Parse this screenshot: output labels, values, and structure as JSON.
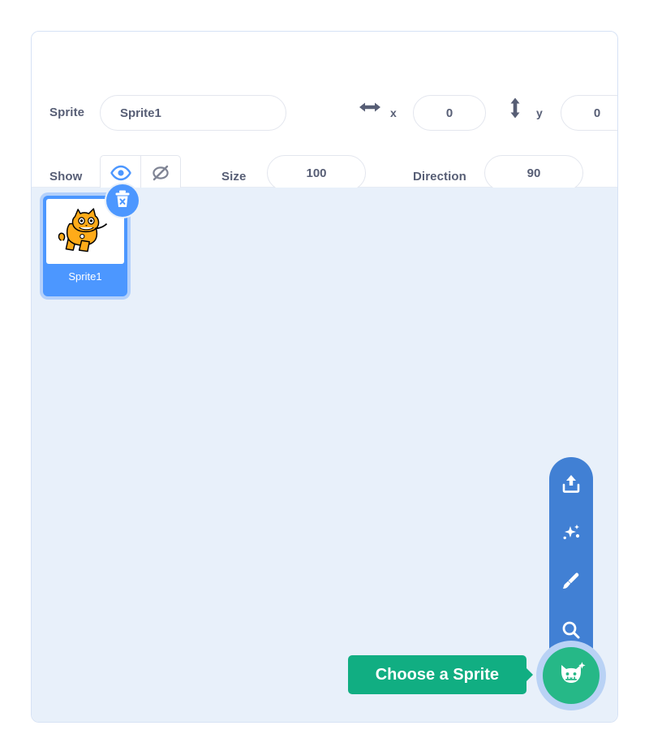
{
  "panel": {
    "name": "sprite-panel"
  },
  "sprite_info": {
    "sprite_label": "Sprite",
    "sprite_name_value": "Sprite1",
    "sprite_name_placeholder": "Sprite1",
    "x_label": "x",
    "x_value": "0",
    "y_label": "y",
    "y_value": "0",
    "show_label": "Show",
    "show_visible_icon": "eye-icon",
    "show_hidden_icon": "eye-slash-icon",
    "show_state": "visible",
    "size_label": "Size",
    "size_value": "100",
    "direction_label": "Direction",
    "direction_value": "90",
    "x_icon": "horizontal-arrows-icon",
    "y_icon": "vertical-arrows-icon"
  },
  "sprite_list": {
    "background_color": "#e8f0fa",
    "sprites": [
      {
        "name": "Sprite1",
        "selected": true,
        "thumbnail": "scratch-cat-icon",
        "delete_badge_icon": "trash-delete-icon"
      }
    ]
  },
  "action_menu": {
    "items": [
      {
        "icon": "upload-icon",
        "name": "upload-sprite"
      },
      {
        "icon": "sparkles-icon",
        "name": "surprise-sprite"
      },
      {
        "icon": "paintbrush-icon",
        "name": "paint-sprite"
      },
      {
        "icon": "search-icon",
        "name": "search-sprite"
      }
    ],
    "main_button_icon": "cat-add-icon",
    "tooltip_label": "Choose a Sprite"
  },
  "colors": {
    "panel_border": "#d6e2f5",
    "list_background": "#e8f0fa",
    "card_selected": "#4c97ff",
    "card_focus_ring": "#b3d0fb",
    "action_column": "#4180d4",
    "fab_green": "#26b887",
    "tooltip_green": "#11ae82",
    "text_gray": "#575e75"
  }
}
